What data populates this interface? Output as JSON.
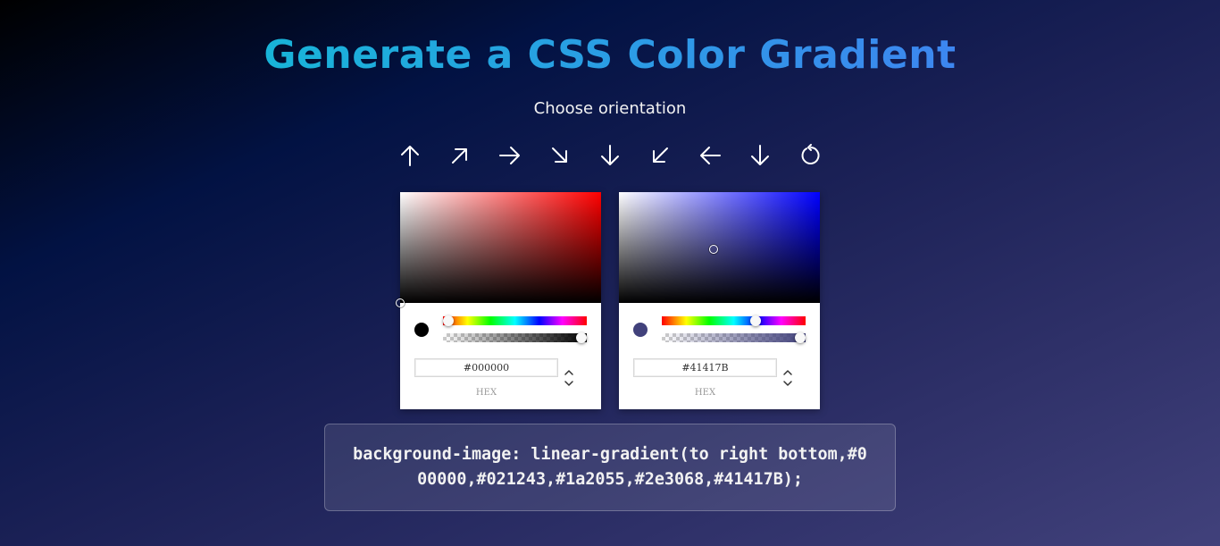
{
  "header": {
    "title": "Generate a CSS Color Gradient",
    "subtitle": "Choose orientation"
  },
  "orientation_buttons": [
    {
      "name": "arrow-up-icon",
      "direction": "to top"
    },
    {
      "name": "arrow-up-right-icon",
      "direction": "to right top"
    },
    {
      "name": "arrow-right-icon",
      "direction": "to right"
    },
    {
      "name": "arrow-down-right-icon",
      "direction": "to right bottom"
    },
    {
      "name": "arrow-down-icon",
      "direction": "to bottom"
    },
    {
      "name": "arrow-down-left-icon",
      "direction": "to left bottom"
    },
    {
      "name": "arrow-left-icon",
      "direction": "to left"
    },
    {
      "name": "arrow-down-icon",
      "direction": "to bottom"
    },
    {
      "name": "radial-refresh-icon",
      "direction": "radial"
    }
  ],
  "pickers": [
    {
      "hex_value": "#000000",
      "hex_label": "HEX",
      "hue_color": "#ff0000",
      "swatch_color": "#000000",
      "hue_fraction": 0.0,
      "alpha_fraction": 1.0,
      "saturation": 0.0,
      "brightness": 0.0
    },
    {
      "hex_value": "#41417B",
      "hex_label": "HEX",
      "hue_color": "#0000ff",
      "swatch_color": "#41417B",
      "hue_fraction": 0.667,
      "alpha_fraction": 1.0,
      "saturation": 0.47,
      "brightness": 0.48
    }
  ],
  "output": {
    "css": "background-image: linear-gradient(to right bottom,#000000,#021243,#1a2055,#2e3068,#41417B);"
  },
  "colors": {
    "title_gradient_start": "#18b4d8",
    "title_gradient_end": "#3d86f0"
  }
}
